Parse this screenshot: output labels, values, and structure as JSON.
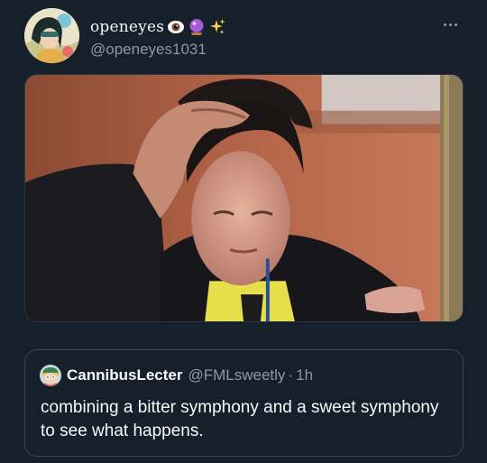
{
  "tweet": {
    "display_name": "openeyes",
    "name_emojis": [
      "eye-icon",
      "crystal-ball-icon",
      "sparkles-icon"
    ],
    "handle": "@openeyes1031",
    "more_icon": "more-dots-icon",
    "media": {
      "kind": "photo"
    }
  },
  "quoted_tweet": {
    "display_name": "CannibusLecter",
    "handle": "@FMLsweetly",
    "separator": "·",
    "time": "1h",
    "text": "combining a bitter symphony and a sweet symphony to see what happens."
  },
  "colors": {
    "background": "#15202b",
    "primary_text": "#f7f9f9",
    "secondary_text": "#8b98a5",
    "border": "#38444d"
  }
}
